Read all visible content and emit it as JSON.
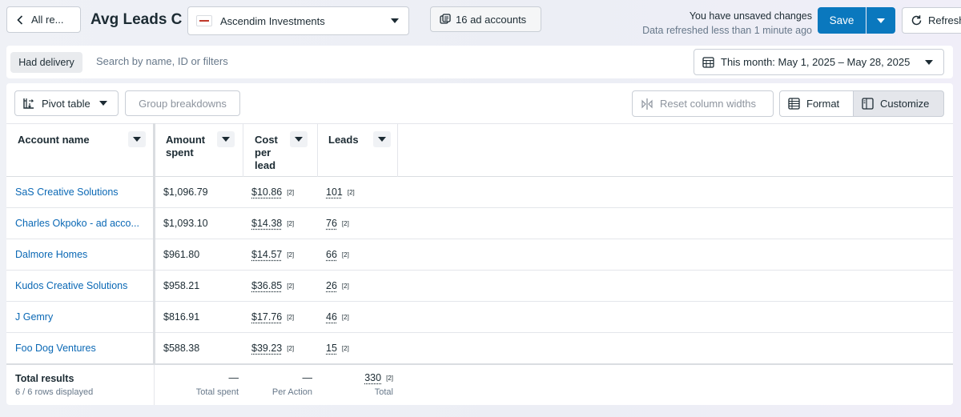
{
  "header": {
    "back_label": "All re...",
    "report_title": "Avg Leads C",
    "account_selected": "Ascendim Investments",
    "ad_accounts_label": "16 ad accounts",
    "unsaved_text": "You have unsaved changes",
    "refreshed_text": "Data refreshed less than 1 minute ago",
    "save_label": "Save",
    "refresh_label": "Refresh"
  },
  "filters": {
    "chip_label": "Had delivery",
    "search_placeholder": "Search by name, ID or filters",
    "date_range_label": "This month: May 1, 2025 – May 28, 2025"
  },
  "toolbar": {
    "pivot_label": "Pivot table",
    "group_label": "Group breakdowns",
    "reset_label": "Reset column widths",
    "format_label": "Format",
    "customize_label": "Customize"
  },
  "table": {
    "columns": [
      "Account name",
      "Amount spent",
      "Cost per lead",
      "Leads"
    ],
    "badge": "[2]",
    "rows": [
      {
        "name": "SaS Creative Solutions",
        "amount": "$1,096.79",
        "cpl": "$10.86",
        "leads": "101"
      },
      {
        "name": "Charles Okpoko - ad acco...",
        "amount": "$1,093.10",
        "cpl": "$14.38",
        "leads": "76"
      },
      {
        "name": "Dalmore Homes",
        "amount": "$961.80",
        "cpl": "$14.57",
        "leads": "66"
      },
      {
        "name": "Kudos Creative Solutions",
        "amount": "$958.21",
        "cpl": "$36.85",
        "leads": "26"
      },
      {
        "name": "J Gemry",
        "amount": "$816.91",
        "cpl": "$17.76",
        "leads": "46"
      },
      {
        "name": "Foo Dog Ventures",
        "amount": "$588.38",
        "cpl": "$39.23",
        "leads": "15"
      }
    ],
    "totals": {
      "title": "Total results",
      "rows_displayed": "6 / 6 rows displayed",
      "amount": "—",
      "amount_label": "Total spent",
      "cpl": "—",
      "cpl_label": "Per Action",
      "leads": "330",
      "leads_label": "Total"
    }
  },
  "colors": {
    "accent": "#0a78be",
    "link": "#0a68b5"
  }
}
